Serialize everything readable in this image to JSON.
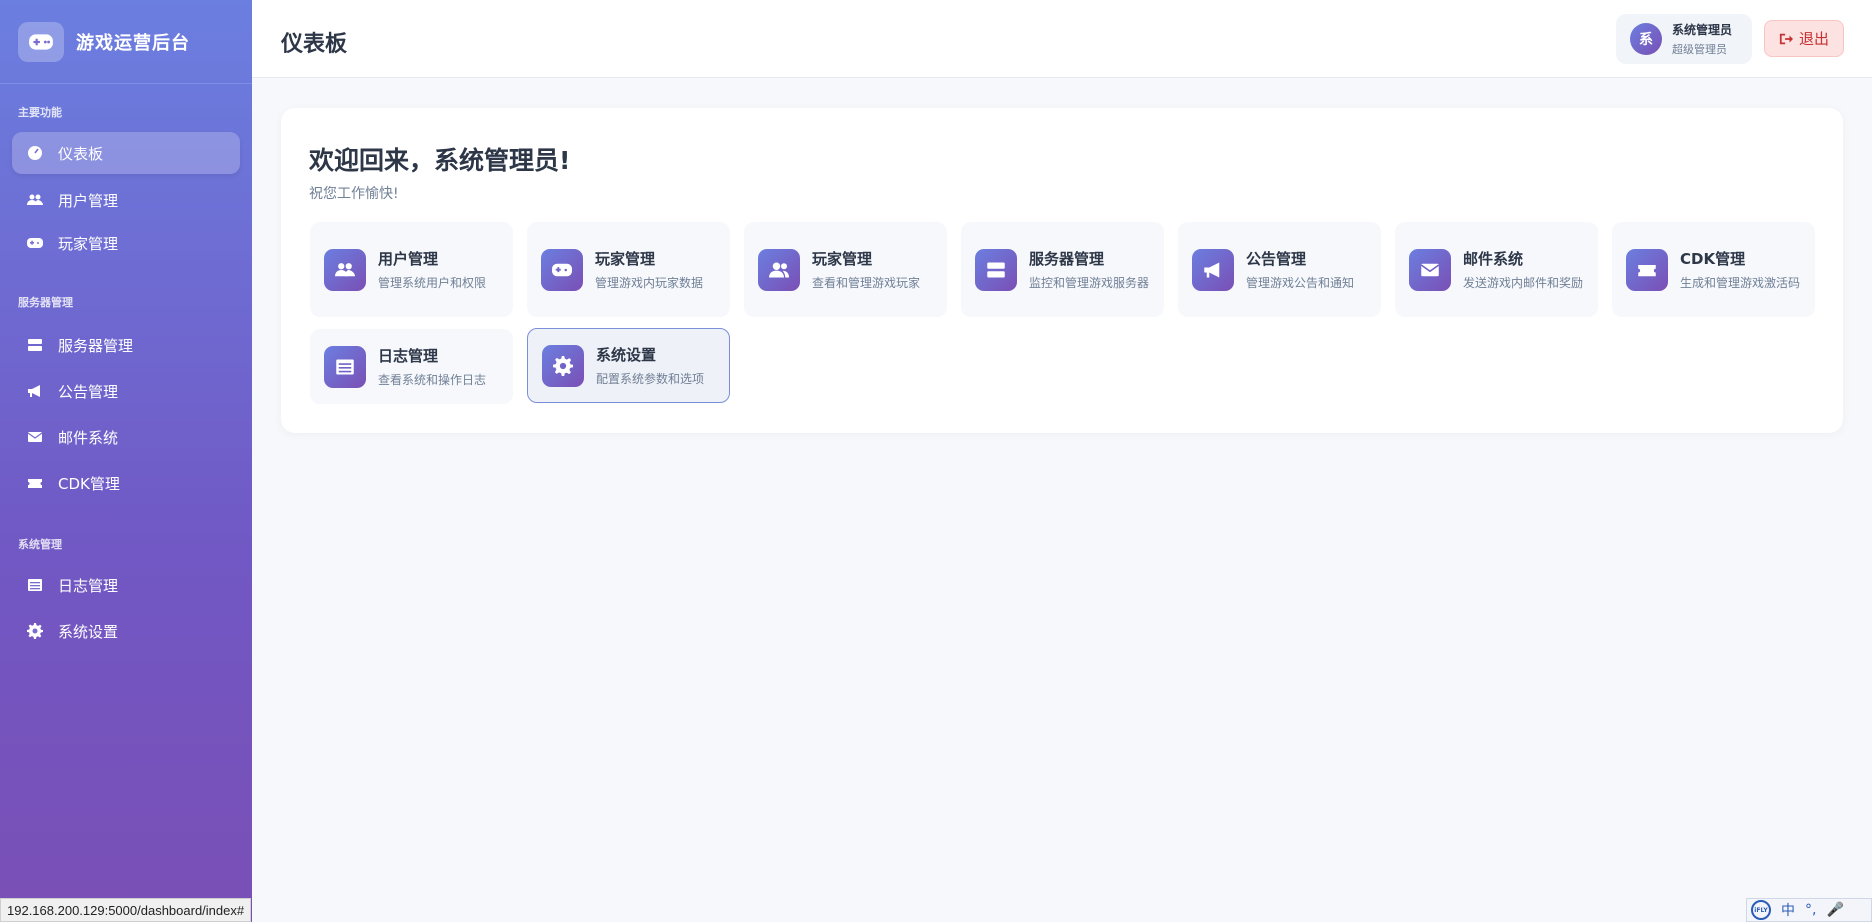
{
  "sidebar": {
    "brand_title": "游戏运营后台",
    "sections": [
      {
        "title": "主要功能",
        "items": [
          {
            "label": "仪表板",
            "icon": "dashboard-icon",
            "active": true
          },
          {
            "label": "用户管理",
            "icon": "users-icon"
          },
          {
            "label": "玩家管理",
            "icon": "gamepad-icon"
          }
        ]
      },
      {
        "title": "服务器管理",
        "items": [
          {
            "label": "服务器管理",
            "icon": "server-icon"
          },
          {
            "label": "公告管理",
            "icon": "megaphone-icon"
          },
          {
            "label": "邮件系统",
            "icon": "envelope-icon"
          },
          {
            "label": "CDK管理",
            "icon": "ticket-icon"
          }
        ]
      },
      {
        "title": "系统管理",
        "items": [
          {
            "label": "日志管理",
            "icon": "list-icon"
          },
          {
            "label": "系统设置",
            "icon": "gear-icon"
          }
        ]
      }
    ]
  },
  "header": {
    "page_title": "仪表板",
    "user": {
      "avatar_char": "系",
      "name": "系统管理员",
      "role": "超级管理员"
    },
    "logout_label": "退出"
  },
  "main": {
    "welcome_title": "欢迎回来，系统管理员!",
    "welcome_sub": "祝您工作愉快!",
    "tiles": [
      {
        "title": "用户管理",
        "desc": "管理系统用户和权限",
        "icon": "users-icon"
      },
      {
        "title": "玩家管理",
        "desc": "管理游戏内玩家数据",
        "icon": "gamepad-icon"
      },
      {
        "title": "玩家管理",
        "desc": "查看和管理游戏玩家",
        "icon": "user-group-icon"
      },
      {
        "title": "服务器管理",
        "desc": "监控和管理游戏服务器",
        "icon": "server-icon"
      },
      {
        "title": "公告管理",
        "desc": "管理游戏公告和通知",
        "icon": "megaphone-icon"
      },
      {
        "title": "邮件系统",
        "desc": "发送游戏内邮件和奖励",
        "icon": "envelope-icon"
      },
      {
        "title": "CDK管理",
        "desc": "生成和管理游戏激活码",
        "icon": "ticket-icon"
      },
      {
        "title": "日志管理",
        "desc": "查看系统和操作日志",
        "icon": "list-icon"
      },
      {
        "title": "系统设置",
        "desc": "配置系统参数和选项",
        "icon": "gear-icon",
        "selected": true
      }
    ]
  },
  "status_bar": {
    "url": "192.168.200.129:5000/dashboard/index#",
    "ime_label": "中",
    "ime_logo": "iFLY"
  },
  "colors": {
    "sidebar_gradient_start": "#6b7fe0",
    "sidebar_gradient_end": "#7a4fb5",
    "logout_bg": "#fde2e2",
    "logout_text": "#c53030"
  }
}
